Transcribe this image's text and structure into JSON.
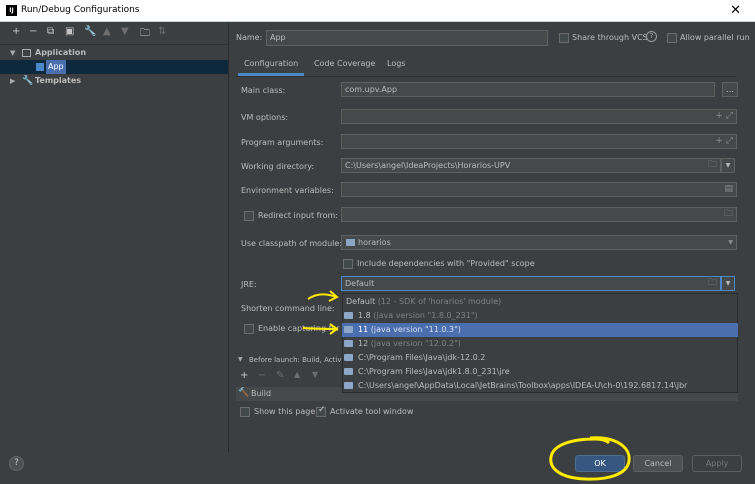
{
  "window": {
    "title": "Run/Debug Configurations",
    "close_label": "✕"
  },
  "tree": {
    "application_label": "Application",
    "app_label": "App",
    "templates_label": "Templates"
  },
  "header": {
    "name_label": "Name:",
    "name_value": "App",
    "share_label": "Share through VCS",
    "share_help": "?",
    "parallel_label": "Allow parallel run"
  },
  "tabs": [
    "Configuration",
    "Code Coverage",
    "Logs"
  ],
  "form": {
    "main_class_label": "Main class:",
    "main_class_value": "com.upv.App",
    "vm_options_label": "VM options:",
    "program_args_label": "Program arguments:",
    "working_dir_label": "Working directory:",
    "working_dir_value": "C:\\Users\\angel\\IdeaProjects\\Horarios-UPV",
    "env_vars_label": "Environment variables:",
    "redirect_label": "Redirect input from:",
    "classpath_label": "Use classpath of module:",
    "classpath_value": "horarios",
    "include_deps_label": "Include dependencies with \"Provided\" scope",
    "jre_label": "JRE:",
    "jre_value": "Default",
    "shorten_label": "Shorten command line:",
    "enable_capturing_label": "Enable capturing for",
    "before_launch_label": "Before launch: Build, Activ",
    "build_task_label": "Build",
    "show_page_label": "Show this page",
    "activate_tool_label": "Activate tool window"
  },
  "jre_dropdown": [
    {
      "main": "Default",
      "sub": " (12 - SDK of 'horarios' module)"
    },
    {
      "main": "1.8",
      "sub": " (java version \"1.8.0_231\")"
    },
    {
      "main": "11",
      "sub": " (java version \"11.0.3\")"
    },
    {
      "main": "12",
      "sub": " (java version \"12.0.2\")"
    },
    {
      "main": "C:\\Program Files\\Java\\jdk-12.0.2",
      "sub": ""
    },
    {
      "main": "C:\\Program Files\\Java\\jdk1.8.0_231\\jre",
      "sub": ""
    },
    {
      "main": "C:\\Users\\angel\\AppData\\Local\\JetBrains\\Toolbox\\apps\\IDEA-U\\ch-0\\192.6817.14\\jbr",
      "sub": ""
    }
  ],
  "buttons": {
    "help": "?",
    "ok": "OK",
    "cancel": "Cancel",
    "apply": "Apply"
  },
  "colors": {
    "background": "#3c3f41",
    "selection": "#4b6eaf",
    "annotation": "#ffeb00",
    "primary_button": "#365880"
  },
  "icons": [
    "add-icon",
    "remove-icon",
    "copy-icon",
    "save-icon",
    "wrench-icon",
    "move-up-icon",
    "move-down-icon",
    "folder-icon",
    "sort-icon",
    "expand-icon",
    "browse-folder-icon",
    "help-icon"
  ]
}
